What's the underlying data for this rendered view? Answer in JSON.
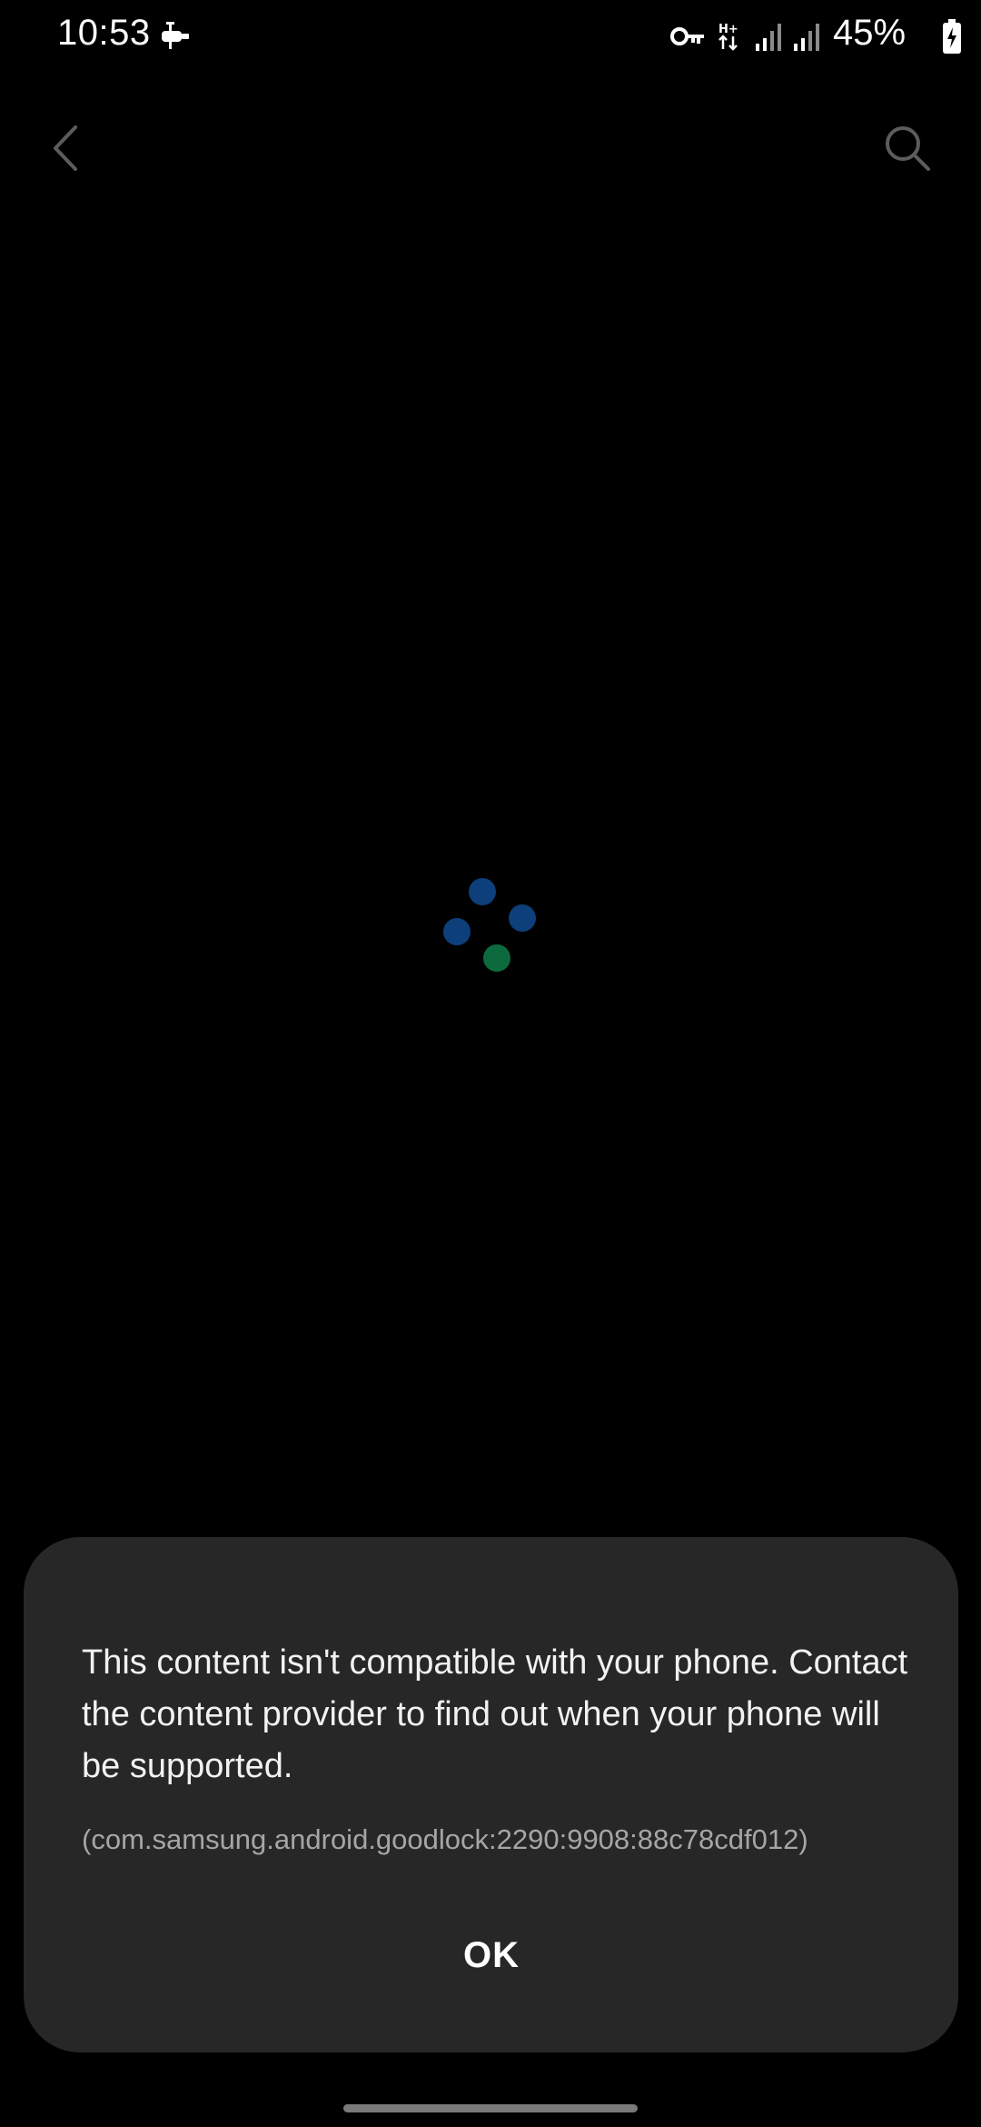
{
  "status_bar": {
    "time": "10:53",
    "battery_percent": "45%",
    "icons": [
      "system-notification-icon",
      "vpn-key-icon",
      "hplus-data-icon",
      "signal-1-icon",
      "signal-2-icon",
      "battery-charging-icon"
    ]
  },
  "app_bar": {
    "back_icon": "chevron-left-icon",
    "search_icon": "search-icon"
  },
  "loading": {
    "colors": [
      "#0d3f7a",
      "#0d3f7a",
      "#0d3f7a",
      "#0c6a3e"
    ]
  },
  "dialog": {
    "message": "This content isn't compatible with your phone. Contact the content provider to find out when your phone will be supported.",
    "code": "(com.samsung.android.goodlock:2290:9908:88c78cdf012)",
    "ok_label": "OK"
  },
  "colors": {
    "background": "#000000",
    "dialog_background": "#272727",
    "secondary_text": "#a6a6a6"
  }
}
